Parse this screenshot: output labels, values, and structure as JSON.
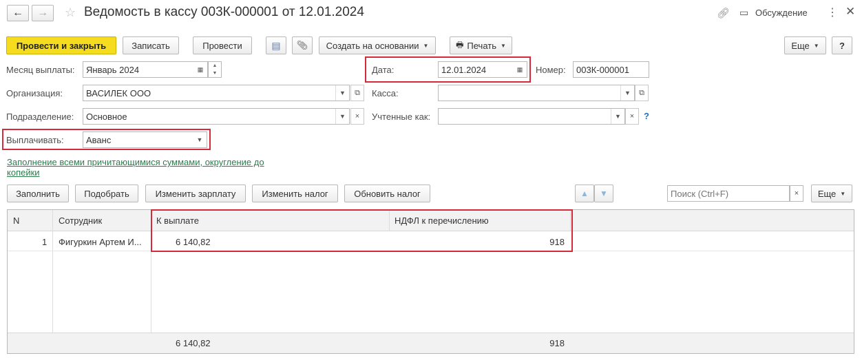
{
  "header": {
    "title": "Ведомость в кассу 003К-000001 от 12.01.2024",
    "discussion": "Обсуждение"
  },
  "toolbar": {
    "post_close": "Провести и закрыть",
    "save": "Записать",
    "post": "Провести",
    "create_based": "Создать на основании",
    "print": "Печать",
    "more": "Еще",
    "help": "?"
  },
  "form": {
    "month_label": "Месяц выплаты:",
    "month_value": "Январь 2024",
    "date_label": "Дата:",
    "date_value": "12.01.2024",
    "number_label": "Номер:",
    "number_value": "003К-000001",
    "org_label": "Организация:",
    "org_value": "ВАСИЛЕК ООО",
    "cash_label": "Касса:",
    "cash_value": "",
    "dept_label": "Подразделение:",
    "dept_value": "Основное",
    "counted_label": "Учтенные как:",
    "counted_value": "",
    "counted_help": "?",
    "pay_label": "Выплачивать:",
    "pay_value": "Аванс",
    "fill_link_1": "Заполнение всеми причитающимися суммами, округление до",
    "fill_link_2": "копейки"
  },
  "table_toolbar": {
    "fill": "Заполнить",
    "select": "Подобрать",
    "change_salary": "Изменить зарплату",
    "change_tax": "Изменить налог",
    "update_tax": "Обновить налог",
    "search_placeholder": "Поиск (Ctrl+F)",
    "more": "Еще"
  },
  "table": {
    "columns": [
      "N",
      "Сотрудник",
      "К выплате",
      "НДФЛ к перечислению"
    ],
    "rows": [
      {
        "n": "1",
        "employee": "Фигуркин Артем И...",
        "pay": "6 140,82",
        "tax": "918"
      }
    ],
    "footer": {
      "pay": "6 140,82",
      "tax": "918"
    }
  },
  "colors": {
    "accent_yellow": "#f5dc1e",
    "highlight_red": "#d42a3a",
    "link_green": "#2c7d4c"
  }
}
